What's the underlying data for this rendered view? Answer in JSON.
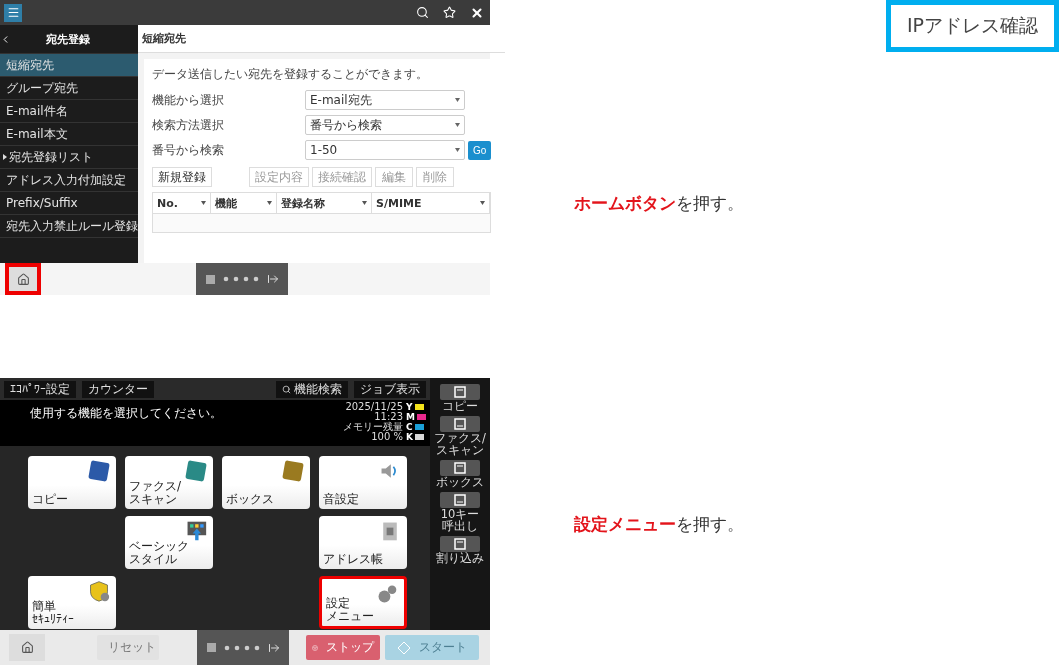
{
  "tag": "IPアドレス確認",
  "steps": [
    {
      "screen": {
        "kind": "web",
        "sidebar": {
          "title": "宛先登録",
          "items": [
            {
              "label": "短縮宛先",
              "selected": true,
              "expandable": false
            },
            {
              "label": "グループ宛先",
              "selected": false,
              "expandable": false
            },
            {
              "label": "E-mail件名",
              "selected": false,
              "expandable": false
            },
            {
              "label": "E-mail本文",
              "selected": false,
              "expandable": false
            },
            {
              "label": "宛先登録リスト",
              "selected": false,
              "expandable": true
            },
            {
              "label": "アドレス入力付加設定",
              "selected": false,
              "expandable": false
            },
            {
              "label": "Prefix/Suffix",
              "selected": false,
              "expandable": false
            },
            {
              "label": "宛先入力禁止ルール登録",
              "selected": false,
              "expandable": false
            }
          ]
        },
        "page_title": "短縮宛先",
        "description": "データ送信したい宛先を登録することができます。",
        "form": [
          {
            "label": "機能から選択",
            "value": "E-mail宛先"
          },
          {
            "label": "検索方法選択",
            "value": "番号から検索"
          },
          {
            "label": "番号から検索",
            "value": "1-50",
            "go": "Go"
          }
        ],
        "actions": [
          {
            "label": "新規登録",
            "disabled": false
          },
          {
            "label": "設定内容",
            "disabled": true
          },
          {
            "label": "接続確認",
            "disabled": true
          },
          {
            "label": "編集",
            "disabled": true
          },
          {
            "label": "削除",
            "disabled": true
          }
        ],
        "columns": [
          "No.",
          "機能",
          "登録名称",
          "S/MIME"
        ],
        "home_highlighted": true
      },
      "caption": [
        {
          "text": "ホームボタン",
          "highlight": true
        },
        {
          "text": "を押す。",
          "highlight": false
        }
      ]
    },
    {
      "screen": {
        "kind": "panel",
        "top_buttons": [
          "ｴｺﾊﾟﾜｰ設定",
          "カウンター"
        ],
        "search_button": "機能検索",
        "job_button": "ジョブ表示",
        "message": "使用する機能を選択してください。",
        "status": [
          "2025/11/25",
          "11:23",
          "メモリー残量",
          "100 %"
        ],
        "toner": [
          {
            "label": "Y",
            "color": "#f2e21a"
          },
          {
            "label": "M",
            "color": "#e8288c"
          },
          {
            "label": "C",
            "color": "#1aa0d8"
          },
          {
            "label": "K",
            "color": "#d8d8d8"
          }
        ],
        "tiles": [
          {
            "kind": "tile",
            "lines": [
              "コピー"
            ],
            "highlighted": false
          },
          {
            "kind": "tile",
            "lines": [
              "ファクス/",
              "スキャン"
            ],
            "highlighted": false
          },
          {
            "kind": "tile",
            "lines": [
              "ボックス"
            ],
            "highlighted": false
          },
          {
            "kind": "tile",
            "lines": [
              "音設定"
            ],
            "highlighted": false
          },
          {
            "kind": "blank"
          },
          {
            "kind": "tile",
            "lines": [
              "ベーシック",
              "スタイル"
            ],
            "highlighted": false
          },
          {
            "kind": "blank"
          },
          {
            "kind": "tile",
            "lines": [
              "アドレス帳"
            ],
            "highlighted": false
          },
          {
            "kind": "tile",
            "lines": [
              "簡単",
              "ｾｷｭﾘﾃｨｰ"
            ],
            "highlighted": false
          },
          {
            "kind": "blank"
          },
          {
            "kind": "blank"
          },
          {
            "kind": "tile",
            "lines": [
              "設定",
              "メニュー"
            ],
            "highlighted": true
          }
        ],
        "side_buttons": [
          {
            "lines": [
              "コピー"
            ]
          },
          {
            "lines": [
              "ファクス/",
              "スキャン"
            ]
          },
          {
            "lines": [
              "ボックス"
            ]
          },
          {
            "lines": [
              "10キー",
              "呼出し"
            ]
          },
          {
            "lines": [
              "割り込み"
            ]
          }
        ],
        "reset": {
          "label": "リセット",
          "disabled": true
        },
        "stop": "ストップ",
        "start": {
          "label": "スタート",
          "disabled": true
        },
        "home_highlighted": false
      },
      "caption": [
        {
          "text": "設定メニュー",
          "highlight": true
        },
        {
          "text": "を押す。",
          "highlight": false
        }
      ]
    }
  ]
}
